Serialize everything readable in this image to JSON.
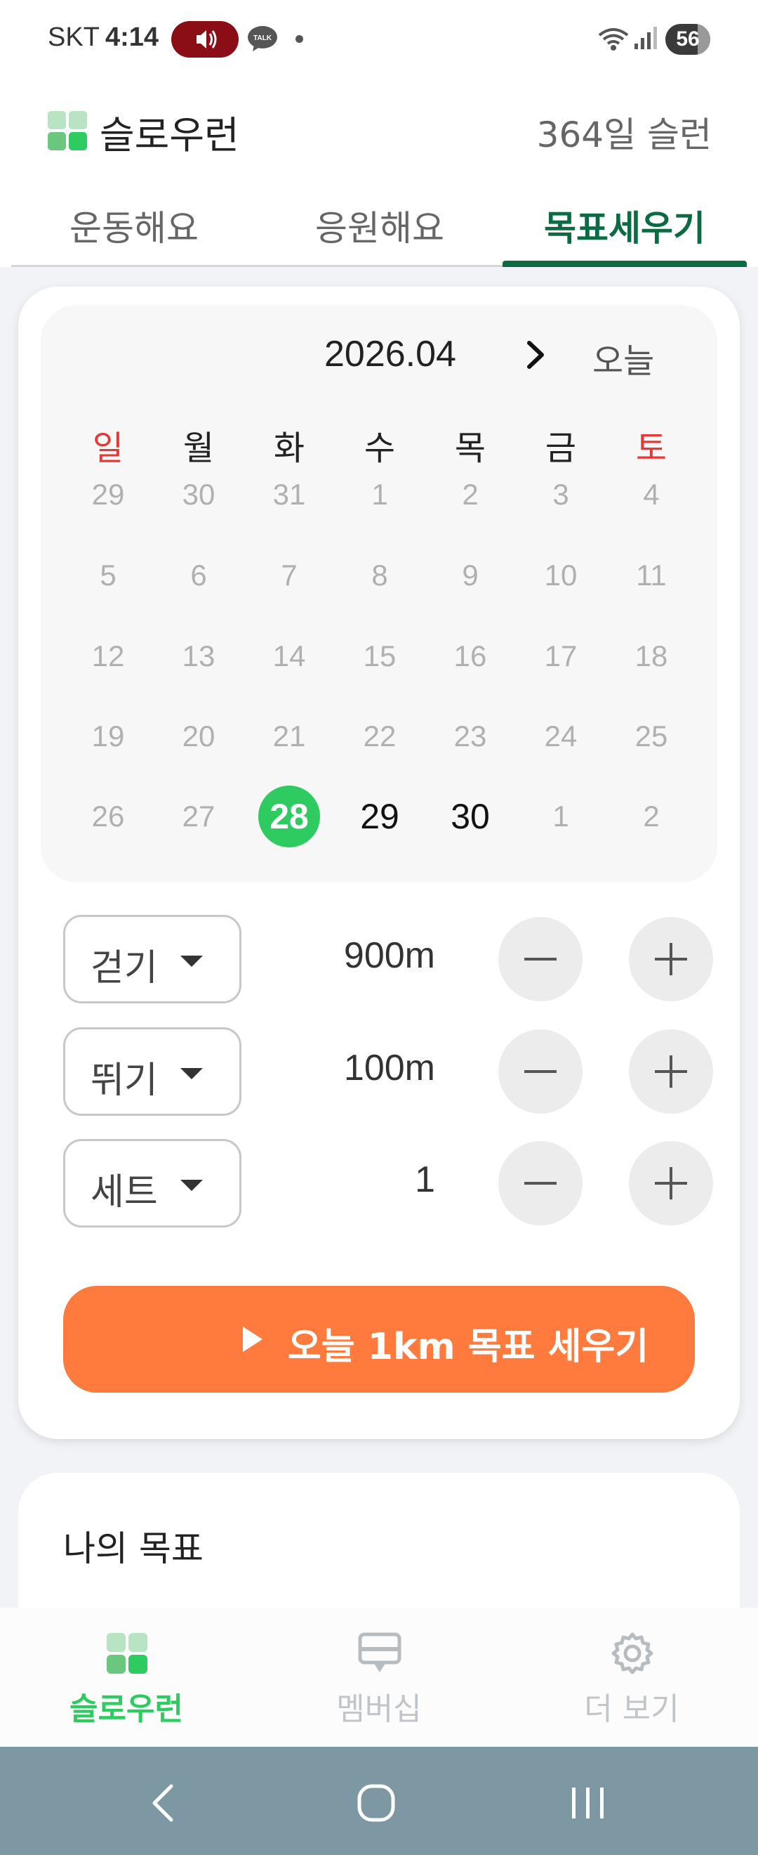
{
  "status_bar": {
    "carrier": "SKT",
    "time": "4:14",
    "battery": "56"
  },
  "header": {
    "app_title": "슬로우런",
    "streak": "364일 슬런"
  },
  "tabs": [
    {
      "label": "운동해요"
    },
    {
      "label": "응원해요"
    },
    {
      "label": "목표세우기"
    }
  ],
  "calendar": {
    "month": "2026.04",
    "today_button": "오늘",
    "weekdays": [
      "일",
      "월",
      "화",
      "수",
      "목",
      "금",
      "토"
    ],
    "weeks": [
      [
        "29",
        "30",
        "31",
        "1",
        "2",
        "3",
        "4"
      ],
      [
        "5",
        "6",
        "7",
        "8",
        "9",
        "10",
        "11"
      ],
      [
        "12",
        "13",
        "14",
        "15",
        "16",
        "17",
        "18"
      ],
      [
        "19",
        "20",
        "21",
        "22",
        "23",
        "24",
        "25"
      ],
      [
        "26",
        "27",
        "28",
        "29",
        "30",
        "1",
        "2"
      ]
    ],
    "selected_day": "28"
  },
  "plan": {
    "rows": [
      {
        "type": "걷기",
        "value": "900m"
      },
      {
        "type": "뛰기",
        "value": "100m"
      },
      {
        "type": "세트",
        "value": "1"
      }
    ],
    "cta_label": "오늘 1km 목표 세우기"
  },
  "goals": {
    "title": "나의 목표"
  },
  "bottom_nav": [
    {
      "label": "슬로우런"
    },
    {
      "label": "멤버십"
    },
    {
      "label": "더 보기"
    }
  ],
  "colors": {
    "accent_green": "#2ecc60",
    "tab_green": "#0d6b43",
    "cta_orange": "#ff7a3d",
    "weekend_red": "#e53935"
  }
}
